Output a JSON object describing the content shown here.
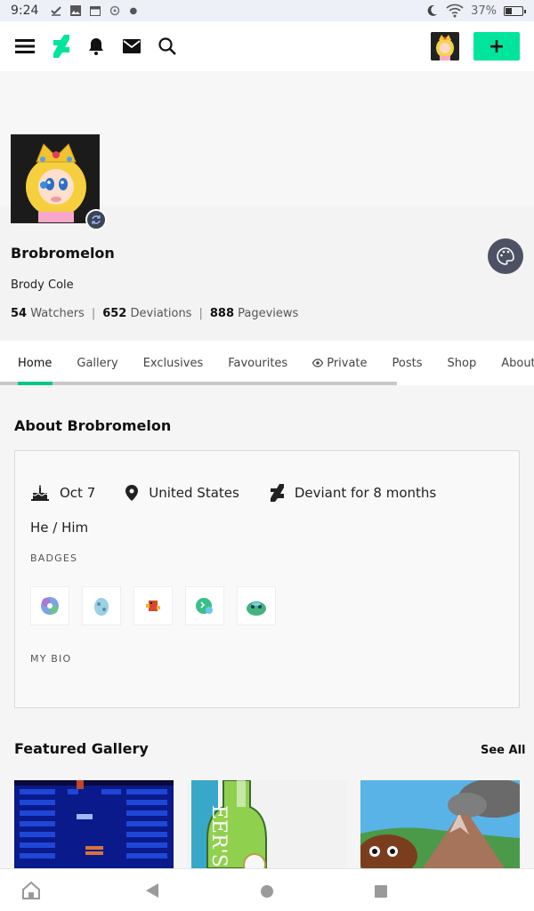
{
  "status_bar": {
    "time": "9:24",
    "battery": "37%"
  },
  "top_nav": {
    "menu_icon": "hamburger-icon",
    "logo": "deviantart-logo",
    "plus_label": "+"
  },
  "profile": {
    "username": "Brobromelon",
    "real_name": "Brody Cole",
    "stats": [
      {
        "value": "54",
        "label": "Watchers"
      },
      {
        "value": "652",
        "label": "Deviations"
      },
      {
        "value": "888",
        "label": "Pageviews"
      }
    ]
  },
  "tabs": [
    "Home",
    "Gallery",
    "Exclusives",
    "Favourites",
    "Private",
    "Posts",
    "Shop",
    "About"
  ],
  "about": {
    "title": "About Brobromelon",
    "birthday": "Oct 7",
    "location": "United States",
    "deviant_for": "Deviant for 8 months",
    "pronouns": "He / Him",
    "badges_label": "BADGES",
    "bio_label": "MY BIO"
  },
  "featured": {
    "title": "Featured Gallery",
    "see_all": "See All"
  },
  "colors": {
    "accent": "#00e59b",
    "tab_underline": "#00c787"
  }
}
